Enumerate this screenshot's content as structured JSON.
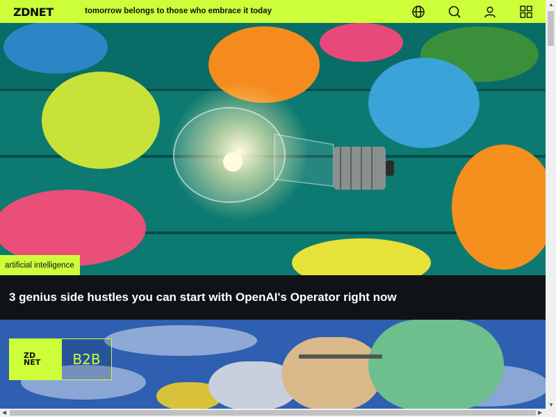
{
  "header": {
    "logo": "ZDNET",
    "tagline": "tomorrow belongs to those who embrace it today",
    "icons": [
      "globe-icon",
      "search-icon",
      "user-icon",
      "grid-icon"
    ]
  },
  "hero": {
    "tag": "artificial intelligence",
    "headline": "3 genius side hustles you can start with OpenAI's Operator right now"
  },
  "card2": {
    "badge_logo_top": "ZD",
    "badge_logo_bottom": "NET",
    "badge_label": "B2B"
  },
  "colors": {
    "accent": "#ccff3a",
    "headline_bg": "#0f1217"
  }
}
